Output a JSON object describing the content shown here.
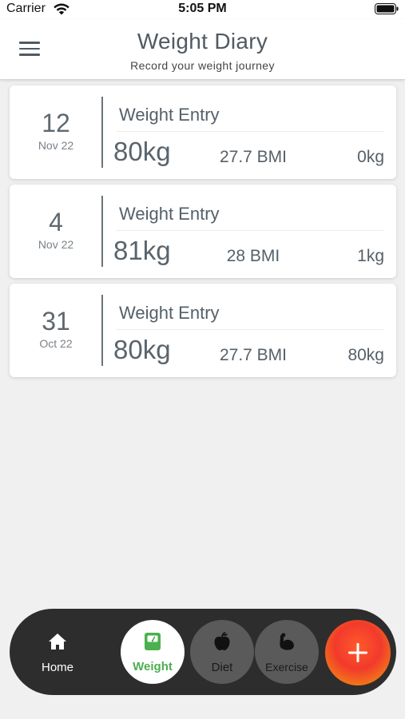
{
  "status_bar": {
    "carrier": "Carrier",
    "time": "5:05 PM"
  },
  "header": {
    "title": "Weight Diary",
    "subtitle": "Record your weight journey",
    "menu_icon": "hamburger-menu-icon"
  },
  "entries": [
    {
      "day": "12",
      "month": "Nov 22",
      "title": "Weight Entry",
      "weight": "80kg",
      "bmi": "27.7 BMI",
      "change": "0kg"
    },
    {
      "day": "4",
      "month": "Nov 22",
      "title": "Weight Entry",
      "weight": "81kg",
      "bmi": "28 BMI",
      "change": "1kg"
    },
    {
      "day": "31",
      "month": "Oct 22",
      "title": "Weight Entry",
      "weight": "80kg",
      "bmi": "27.7 BMI",
      "change": "80kg"
    }
  ],
  "nav": {
    "home": {
      "label": "Home",
      "icon": "home-icon"
    },
    "weight": {
      "label": "Weight",
      "icon": "scale-icon"
    },
    "diet": {
      "label": "Diet",
      "icon": "apple-icon"
    },
    "exercise": {
      "label": "Exercise",
      "icon": "flexed-bicep-icon"
    },
    "add": {
      "icon": "plus-icon"
    }
  },
  "colors": {
    "accent": "#4caf50",
    "header_text": "#4f5a63",
    "nav_background": "#2d2d2d",
    "fab_gradient_start": "#f23a2c",
    "fab_gradient_end": "#f2a20a",
    "page_background": "#f0f0f0"
  }
}
